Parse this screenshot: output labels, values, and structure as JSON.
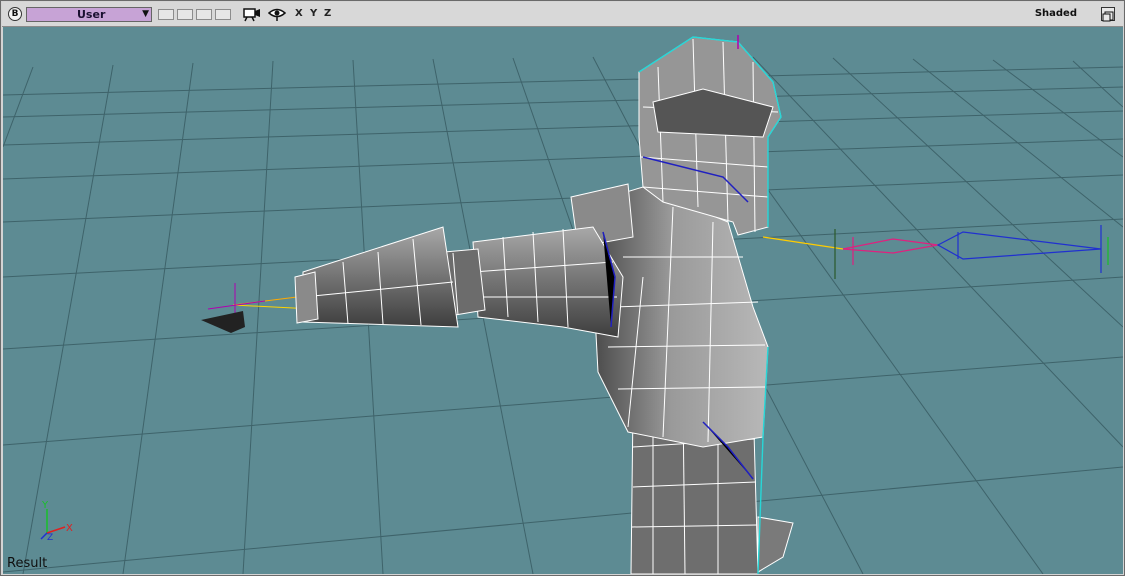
{
  "toolbar": {
    "menu_button": "B",
    "camera_select": {
      "value": "User"
    },
    "axes": [
      "X",
      "Y",
      "Z"
    ],
    "shading_mode": "Shaded"
  },
  "viewport": {
    "status_label": "Result",
    "axis_gizmo": {
      "y_label": "Y",
      "x_label": "X",
      "z_label": "Z"
    },
    "colors": {
      "background": "#5d8b93",
      "grid": "#3b5f66",
      "mesh_fill": "#8a8a8a",
      "wireframe": "#ffffff",
      "selection_outline": "#27d7d7"
    },
    "icons": [
      "camera-icon",
      "eye-icon",
      "maximize-icon"
    ]
  }
}
